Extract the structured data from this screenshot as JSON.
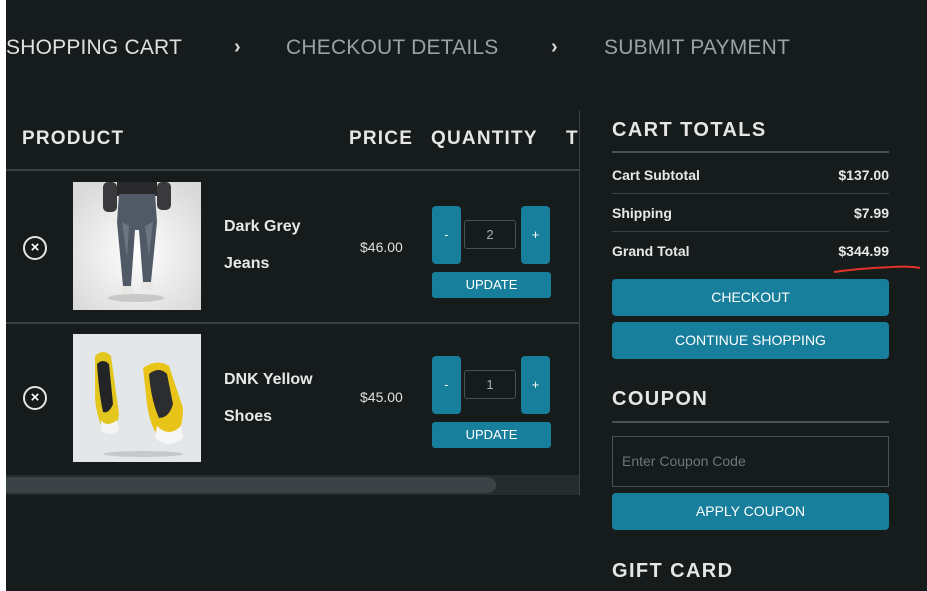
{
  "breadcrumb": {
    "steps": [
      "SHOPPING CART",
      "CHECKOUT DETAILS",
      "SUBMIT PAYMENT"
    ],
    "separator": "›"
  },
  "cart": {
    "headers": {
      "product": "PRODUCT",
      "price": "PRICE",
      "quantity": "QUANTITY",
      "total": "TOTAL"
    },
    "items": [
      {
        "name": "Dark Grey Jeans",
        "price": "$46.00",
        "quantity": "2",
        "minus": "-",
        "plus": "+",
        "update": "UPDATE",
        "remove": "×",
        "image": "jeans-image"
      },
      {
        "name": "DNK Yellow Shoes",
        "price": "$45.00",
        "quantity": "1",
        "minus": "-",
        "plus": "+",
        "update": "UPDATE",
        "remove": "×",
        "image": "shoes-image"
      }
    ]
  },
  "totals": {
    "heading": "CART TOTALS",
    "subtotal_label": "Cart Subtotal",
    "subtotal_value": "$137.00",
    "shipping_label": "Shipping",
    "shipping_value": "$7.99",
    "grand_label": "Grand Total",
    "grand_value": "$344.99",
    "checkout_label": "CHECKOUT",
    "continue_label": "CONTINUE SHOPPING"
  },
  "coupon": {
    "heading": "COUPON",
    "placeholder": "Enter Coupon Code",
    "apply_label": "APPLY COUPON"
  },
  "gift_card": {
    "heading": "GIFT CARD"
  },
  "colors": {
    "background": "#161b1c",
    "accent": "#177e9b",
    "annotation": "#e0322c"
  }
}
